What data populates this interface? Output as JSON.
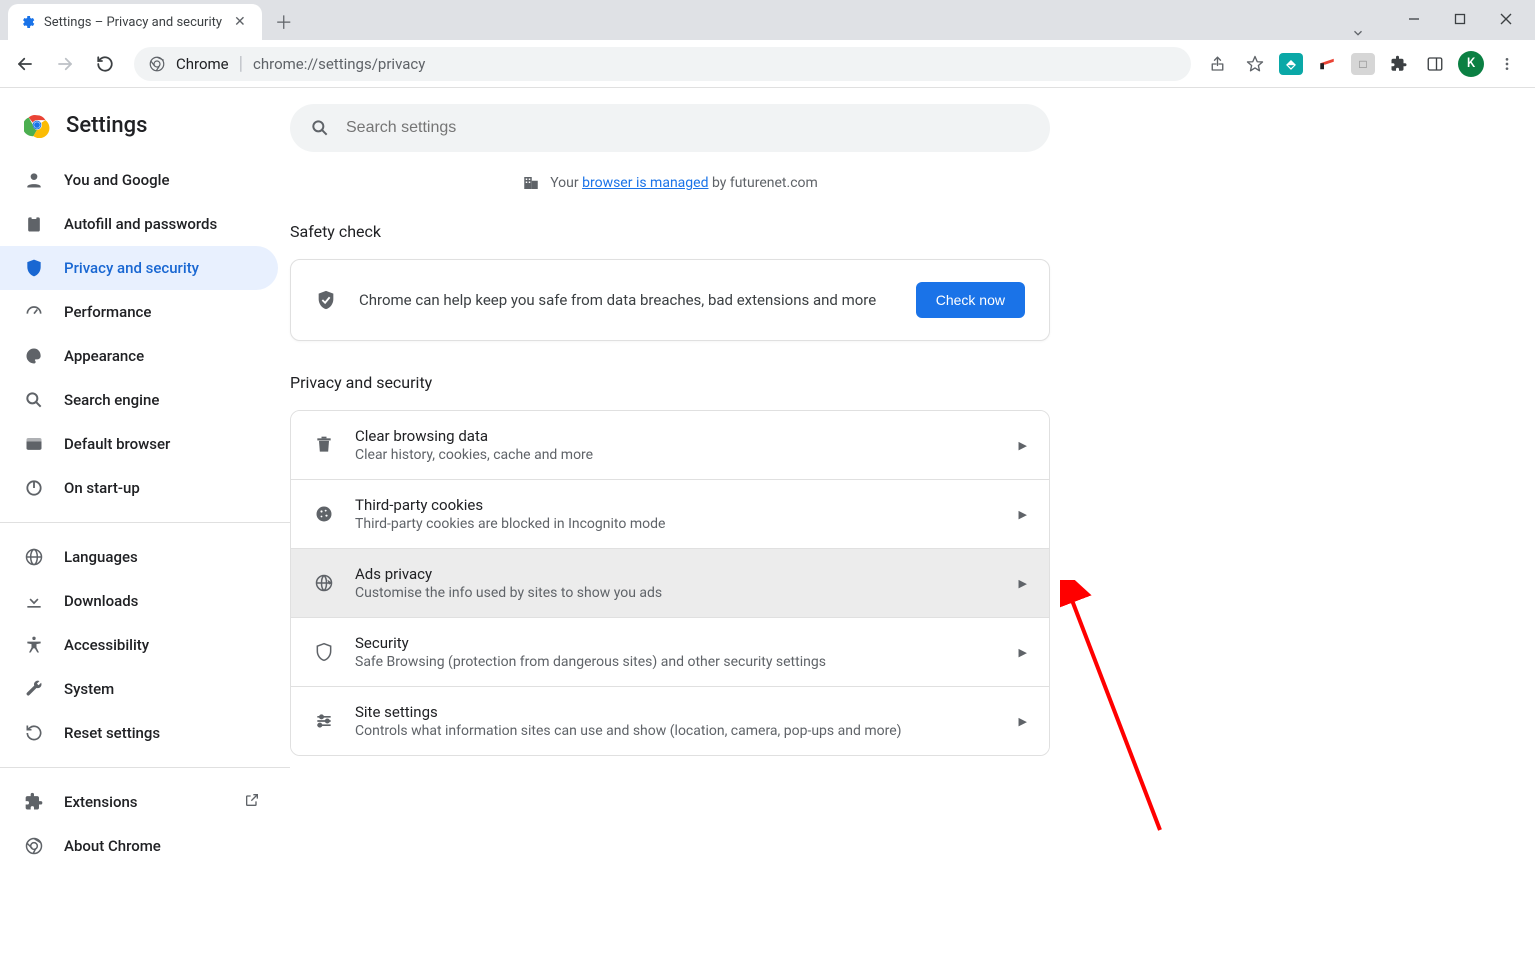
{
  "window": {
    "tab_title": "Settings – Privacy and security"
  },
  "omnibox": {
    "scheme_label": "Chrome",
    "url_display": "chrome://settings/privacy"
  },
  "avatar_letter": "K",
  "sidebar": {
    "brand": "Settings",
    "items": [
      {
        "label": "You and Google"
      },
      {
        "label": "Autofill and passwords"
      },
      {
        "label": "Privacy and security"
      },
      {
        "label": "Performance"
      },
      {
        "label": "Appearance"
      },
      {
        "label": "Search engine"
      },
      {
        "label": "Default browser"
      },
      {
        "label": "On start-up"
      }
    ],
    "items2": [
      {
        "label": "Languages"
      },
      {
        "label": "Downloads"
      },
      {
        "label": "Accessibility"
      },
      {
        "label": "System"
      },
      {
        "label": "Reset settings"
      }
    ],
    "items3": [
      {
        "label": "Extensions"
      },
      {
        "label": "About Chrome"
      }
    ]
  },
  "search": {
    "placeholder": "Search settings"
  },
  "managed": {
    "prefix": "Your ",
    "link": "browser is managed",
    "suffix": " by futurenet.com"
  },
  "safety": {
    "heading": "Safety check",
    "text": "Chrome can help keep you safe from data breaches, bad extensions and more",
    "button": "Check now"
  },
  "privacy": {
    "heading": "Privacy and security",
    "rows": [
      {
        "title": "Clear browsing data",
        "sub": "Clear history, cookies, cache and more"
      },
      {
        "title": "Third-party cookies",
        "sub": "Third-party cookies are blocked in Incognito mode"
      },
      {
        "title": "Ads privacy",
        "sub": "Customise the info used by sites to show you ads"
      },
      {
        "title": "Security",
        "sub": "Safe Browsing (protection from dangerous sites) and other security settings"
      },
      {
        "title": "Site settings",
        "sub": "Controls what information sites can use and show (location, camera, pop-ups and more)"
      }
    ]
  }
}
